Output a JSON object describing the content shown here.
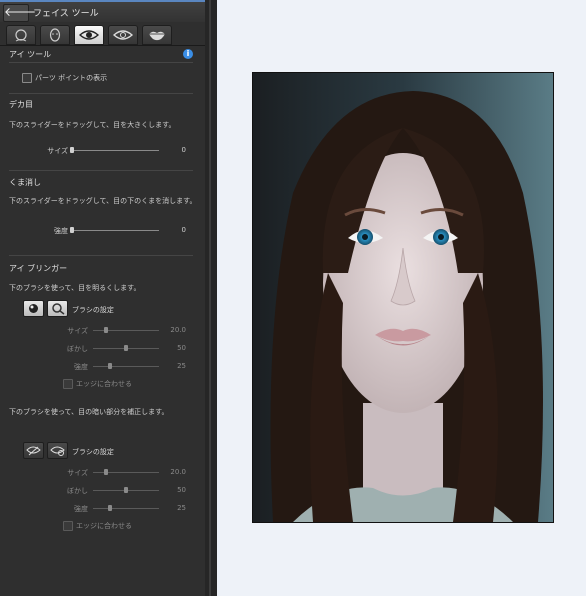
{
  "header": {
    "title": "フェイス ツール",
    "back_icon": "arrow-left-icon"
  },
  "tabs": [
    {
      "name": "face-tab",
      "icon": "face-outline-icon"
    },
    {
      "name": "face-shaper-tab",
      "icon": "face-shape-icon"
    },
    {
      "name": "eye-tab",
      "icon": "eye-icon",
      "active": true
    },
    {
      "name": "eye-bags-tab",
      "icon": "eye-outline-icon"
    },
    {
      "name": "lips-tab",
      "icon": "lips-icon"
    }
  ],
  "eye_tools": {
    "title": "アイ ツール",
    "info_icon": "info-icon",
    "show_parts_label": "パーツ ポイントの表示"
  },
  "big_eye": {
    "title": "デカ目",
    "hint": "下のスライダーをドラッグして、目を大きくします。",
    "slider": {
      "label": "サイズ",
      "value": "0",
      "level": 0
    }
  },
  "dark_circles": {
    "title": "くま消し",
    "hint": "下のスライダーをドラッグして、目の下のくまを消します。",
    "slider": {
      "label": "強度",
      "value": "0",
      "level": 0
    }
  },
  "eye_brightener": {
    "title": "アイ ブリンガー",
    "hint1": "下のブラシを使って、目を明るくします。",
    "brush_settings_label": "ブラシの設定",
    "sliders1": [
      {
        "label": "サイズ",
        "value": "20.0",
        "level": 0.2
      },
      {
        "label": "ぼかし",
        "value": "50",
        "level": 0.5
      },
      {
        "label": "強度",
        "value": "25",
        "level": 0.25
      }
    ],
    "fit_edge_label": "エッジに合わせる",
    "hint2": "下のブラシを使って、目の暗い部分を補正します。",
    "brush_settings_label2": "ブラシの設定",
    "sliders2": [
      {
        "label": "サイズ",
        "value": "20.0",
        "level": 0.2
      },
      {
        "label": "ぼかし",
        "value": "50",
        "level": 0.5
      },
      {
        "label": "強度",
        "value": "25",
        "level": 0.25
      }
    ],
    "fit_edge_label2": "エッジに合わせる"
  },
  "colors": {
    "accent": "#5a86c0",
    "panel": "#2f2f2f",
    "canvas": "#eef2f8"
  }
}
